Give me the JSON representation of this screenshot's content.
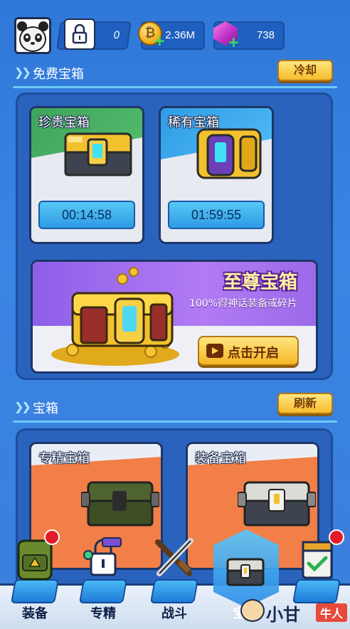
{
  "topbar": {
    "lock_count": "0",
    "coins": "2.36M",
    "gems": "738",
    "coin_glyph": "₿"
  },
  "free_section": {
    "title": "免费宝箱",
    "cooldown_btn": "冷却",
    "cards": [
      {
        "name": "珍贵宝箱",
        "timer": "00:14:58",
        "bg": "#3fa45c"
      },
      {
        "name": "稀有宝箱",
        "timer": "01:59:55",
        "bg": "#3aa5e8"
      }
    ],
    "supreme": {
      "title": "至尊宝箱",
      "desc": "100%得神话装备或碎片",
      "open_btn": "点击开启"
    }
  },
  "chest_section": {
    "title": "宝箱",
    "refresh_btn": "刷新",
    "cards": [
      {
        "name": "专精宝箱"
      },
      {
        "name": "装备宝箱"
      }
    ]
  },
  "nav": {
    "items": [
      {
        "label": "装备",
        "badge": true
      },
      {
        "label": "专精",
        "badge": false
      },
      {
        "label": "战斗",
        "badge": false
      },
      {
        "label": "宝箱",
        "badge": false,
        "active": true
      },
      {
        "label": "",
        "badge": true
      }
    ]
  },
  "watermark": {
    "text1": "小甘",
    "text2": "牛人"
  },
  "colors": {
    "accent_yellow": "#f6bd2c",
    "timer_blue": "#2e9be4",
    "badge_red": "#e21b2a"
  }
}
